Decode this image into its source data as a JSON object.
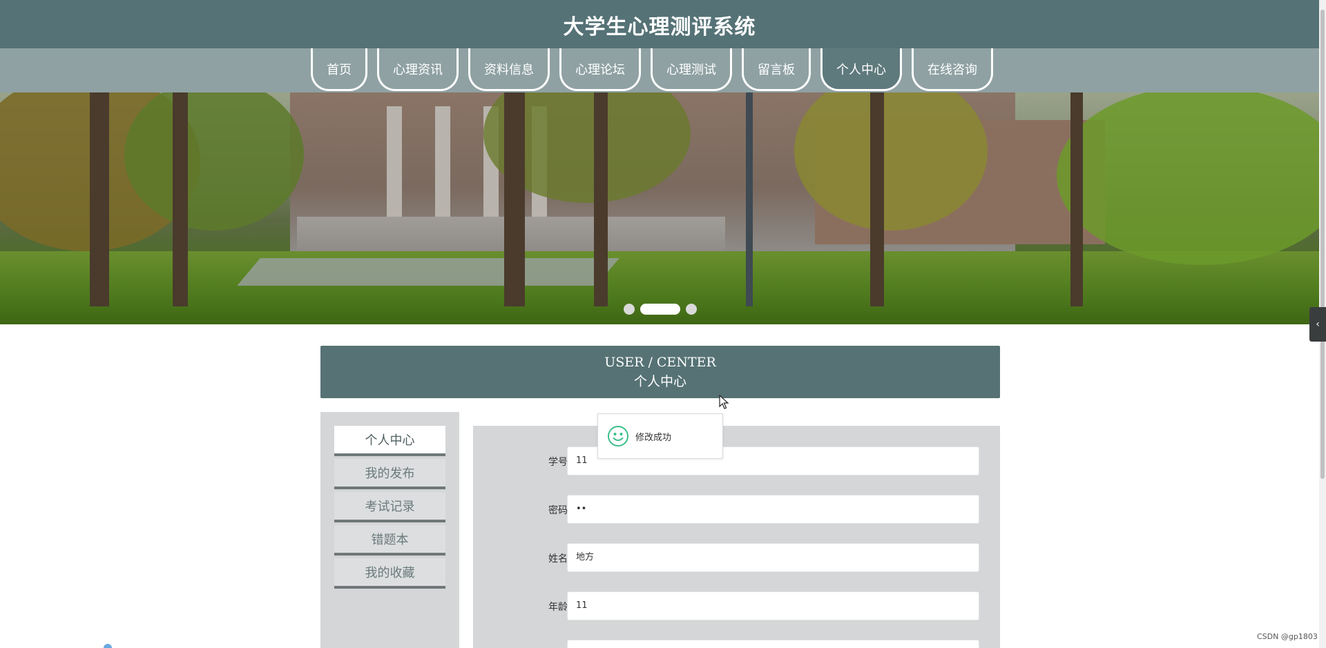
{
  "header": {
    "title": "大学生心理测评系统"
  },
  "nav": {
    "items": [
      {
        "label": "首页",
        "active": false
      },
      {
        "label": "心理资讯",
        "active": false
      },
      {
        "label": "资料信息",
        "active": false
      },
      {
        "label": "心理论坛",
        "active": false
      },
      {
        "label": "心理测试",
        "active": false
      },
      {
        "label": "留言板",
        "active": false
      },
      {
        "label": "个人中心",
        "active": true
      },
      {
        "label": "在线咨询",
        "active": false
      }
    ]
  },
  "banner": {
    "slides": 3,
    "active_slide": 2
  },
  "section": {
    "title_en": "USER / CENTER",
    "title_cn": "个人中心"
  },
  "sidebar": {
    "items": [
      {
        "label": "个人中心",
        "active": true
      },
      {
        "label": "我的发布",
        "active": false
      },
      {
        "label": "考试记录",
        "active": false
      },
      {
        "label": "错题本",
        "active": false
      },
      {
        "label": "我的收藏",
        "active": false
      }
    ]
  },
  "form": {
    "fields": [
      {
        "label": "学号",
        "value": "11"
      },
      {
        "label": "密码",
        "value": "••"
      },
      {
        "label": "姓名",
        "value": "地方"
      },
      {
        "label": "年龄",
        "value": "11"
      }
    ]
  },
  "toast": {
    "message": "修改成功",
    "icon": "smile-icon"
  },
  "float_tab": {
    "icon": "chevron-left-icon",
    "glyph": "‹"
  },
  "watermark": "CSDN @gp1803",
  "colors": {
    "header": "#557276",
    "nav": "#8fa1a3",
    "panel": "#d4d6d7",
    "toast_icon": "#3cbf8a"
  }
}
